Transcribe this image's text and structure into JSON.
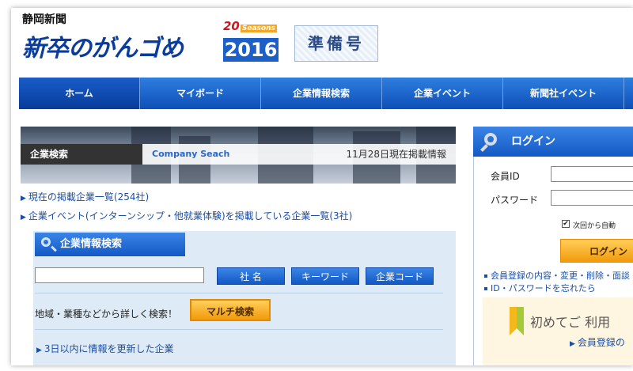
{
  "header": {
    "paper_name": "静岡新聞",
    "site_logo": "新卒のがんゴめ",
    "seasons_number": "20",
    "seasons_word": "Seasons",
    "year": "2016",
    "badge": "準備号"
  },
  "nav": {
    "items": [
      {
        "label": "ホーム"
      },
      {
        "label": "マイボード"
      },
      {
        "label": "企業情報検索"
      },
      {
        "label": "企業イベント"
      },
      {
        "label": "新聞社イベント"
      }
    ]
  },
  "banner": {
    "label": "企業検索",
    "english": "Company Seach",
    "date_info": "11月28日現在掲載情報"
  },
  "links": {
    "listing_all": "現在の掲載企業一覧(254社)",
    "listing_events": "企業イベント(インターンシップ・他就業体験)を掲載している企業一覧(3社)"
  },
  "search": {
    "heading": "企業情報検索",
    "input_value": "",
    "btn_name": "社 名",
    "btn_keyword": "キーワード",
    "btn_code": "企業コード",
    "region_text": "地域・業種などから詳しく検索！",
    "multi_btn": "マルチ検索",
    "updated_link": "3日以内に情報を更新した企業"
  },
  "login": {
    "heading": "ログイン",
    "id_label": "会員ID",
    "password_label": "パスワード",
    "id_value": "",
    "password_value": "",
    "remember_label": "次回から自動",
    "button": "ログイン",
    "link_registration": "会員登録の内容・変更・削除・面談",
    "link_forgot": "ID・パスワードを忘れたら",
    "first_title": "初めてご 利用",
    "first_link": "会員登録の"
  },
  "colors": {
    "nav_blue": "#1358c4",
    "accent_orange": "#f29a0a",
    "link_blue": "#1a4fa8"
  }
}
